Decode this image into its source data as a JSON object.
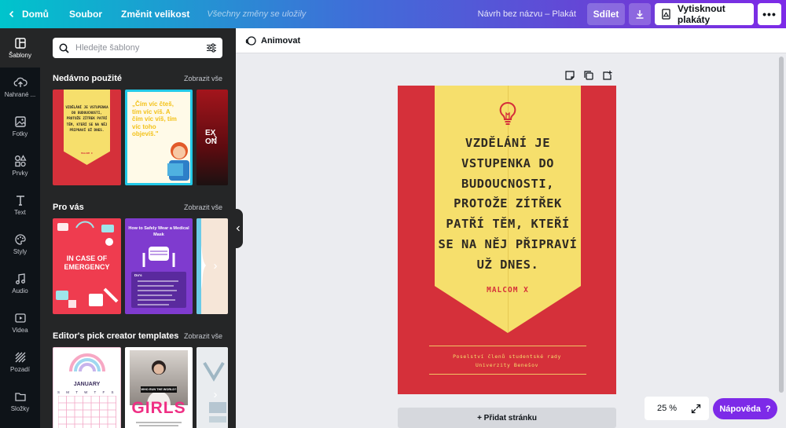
{
  "topbar": {
    "home": "Domů",
    "file": "Soubor",
    "resize": "Změnit velikost",
    "saved_status": "Všechny změny se uložily",
    "doc_title": "Návrh bez názvu – Plakát",
    "share": "Sdílet",
    "print": "Vytisknout plakáty",
    "more": "•••"
  },
  "sidebar": {
    "items": [
      {
        "label": "Šablony",
        "icon": "templates-icon"
      },
      {
        "label": "Nahrané ...",
        "icon": "upload-icon"
      },
      {
        "label": "Fotky",
        "icon": "photos-icon"
      },
      {
        "label": "Prvky",
        "icon": "elements-icon"
      },
      {
        "label": "Text",
        "icon": "text-icon"
      },
      {
        "label": "Styly",
        "icon": "styles-icon"
      },
      {
        "label": "Audio",
        "icon": "audio-icon"
      },
      {
        "label": "Videa",
        "icon": "video-icon"
      },
      {
        "label": "Pozadí",
        "icon": "background-icon"
      },
      {
        "label": "Složky",
        "icon": "folder-icon"
      }
    ]
  },
  "panel": {
    "search_placeholder": "Hledejte šablony",
    "sections": [
      {
        "title": "Nedávno použité",
        "more": "Zobrazit vše"
      },
      {
        "title": "Pro vás",
        "more": "Zobrazit vše"
      },
      {
        "title": "Editor's pick creator templates",
        "more": "Zobrazit vše"
      }
    ],
    "thumbs": {
      "recent_1": "VZDĚLÁNÍ JE VSTUPENKA DO BUDOUCNOSTI, PROTOŽE ZÍTŘEK PATŘÍ TĚM, KTEŘÍ SE NA NĚJ PŘIPRAVÍ UŽ DNES.",
      "recent_1_author": "MALCOM X",
      "recent_2": "„Čím víc čteš, tím víc víš. A čím víc víš, tím víc toho objevíš.\"",
      "recent_3": "EX ON",
      "foryou_1": "IN CASE OF EMERGENCY",
      "foryou_2_title": "How to Safely Wear a Medical Mask",
      "foryou_2_sub": "Do's",
      "editor_1": "JANUARY",
      "editor_1_days": "S M T W T F S",
      "editor_2_tag": "WHO RUN THE WORLD?",
      "editor_2": "GIRLS"
    }
  },
  "editor": {
    "animate": "Animovat",
    "poster": {
      "quote_lines": [
        "VZDĚLÁNÍ JE",
        "VSTUPENKA DO",
        "BUDOUCNOSTI,",
        "PROTOŽE ZÍTŘEK",
        "PATŘÍ TĚM, KTEŘÍ",
        "SE NA NĚJ PŘIPRAVÍ",
        "UŽ DNES."
      ],
      "author": "MALCOM X",
      "footer_line1": "Poselství členů studentské rady",
      "footer_line2": "Univerzity Benešov"
    },
    "add_page": "+ Přidat stránku",
    "zoom": "25 %",
    "help": "Nápověda"
  },
  "colors": {
    "accent": "#7d2ae8",
    "poster_red": "#d5303a",
    "poster_yellow": "#f6df6c",
    "panel_bg": "#252627",
    "rail_bg": "#0e1318"
  }
}
